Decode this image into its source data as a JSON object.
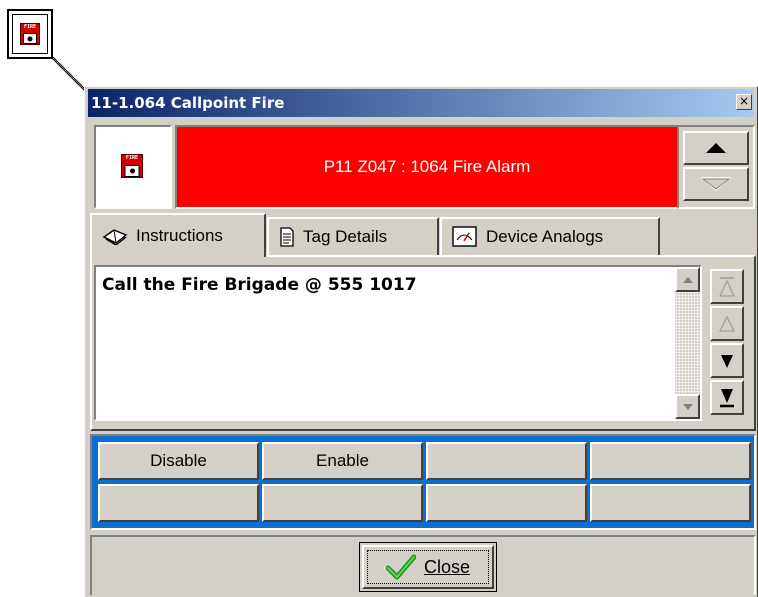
{
  "window": {
    "title": "11-1.064  Callpoint Fire",
    "close_glyph": "×"
  },
  "device_marker": {
    "icon": "fire-callpoint-icon",
    "icon_text": "FIRE"
  },
  "alarm": {
    "icon": "fire-callpoint-icon",
    "icon_text": "FIRE",
    "message": "P11 Z047 : 1064 Fire Alarm",
    "banner_color": "#ff0000"
  },
  "nav": {
    "up_icon": "triangle-up-icon",
    "down_icon": "triangle-down-icon"
  },
  "tabs": [
    {
      "label": "Instructions",
      "icon": "book-icon",
      "active": true
    },
    {
      "label": "Tag Details",
      "icon": "document-icon",
      "active": false
    },
    {
      "label": "Device Analogs",
      "icon": "gauge-icon",
      "active": false
    }
  ],
  "instructions": {
    "text": "Call the Fire Brigade @ 555 1017"
  },
  "actions": {
    "background": "#0a6fd0",
    "row1": [
      "Disable",
      "Enable",
      "",
      ""
    ],
    "row2": [
      "",
      "",
      "",
      ""
    ]
  },
  "footer": {
    "close_label": "Close",
    "close_icon": "checkmark-icon"
  }
}
